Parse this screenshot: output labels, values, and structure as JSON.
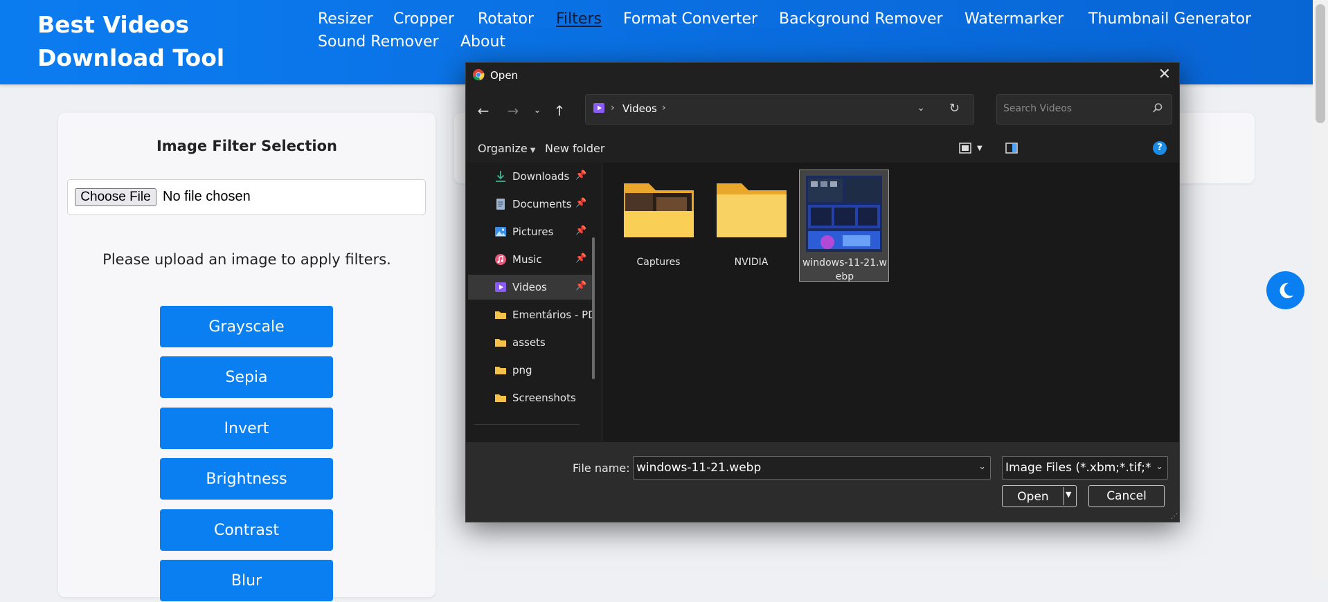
{
  "site": {
    "brand": "Best Videos Download Tool",
    "nav": [
      {
        "label": "Resizer"
      },
      {
        "label": "Cropper"
      },
      {
        "label": "Rotator"
      },
      {
        "label": "Filters",
        "active": true
      },
      {
        "label": "Format Converter"
      },
      {
        "label": "Background Remover"
      },
      {
        "label": "Watermarker"
      },
      {
        "label": "Thumbnail Generator"
      },
      {
        "label": "Sound Remover"
      },
      {
        "label": "About"
      }
    ]
  },
  "filter_panel": {
    "title": "Image Filter Selection",
    "choose_file_label": "Choose File",
    "no_file_text": "No file chosen",
    "upload_message": "Please upload an image to apply filters.",
    "buttons": [
      "Grayscale",
      "Sepia",
      "Invert",
      "Brightness",
      "Contrast",
      "Blur"
    ]
  },
  "dark_mode_toggle": {
    "icon": "moon-icon"
  },
  "dialog": {
    "title": "Open",
    "close_label": "✕",
    "address": {
      "folder": "Videos"
    },
    "search_placeholder": "Search Videos",
    "toolbar": {
      "organize": "Organize",
      "new_folder": "New folder",
      "help": "?"
    },
    "nav_pane": [
      {
        "label": "Downloads",
        "icon": "download-icon",
        "pinned": true
      },
      {
        "label": "Documents",
        "icon": "documents-icon",
        "pinned": true
      },
      {
        "label": "Pictures",
        "icon": "pictures-icon",
        "pinned": true
      },
      {
        "label": "Music",
        "icon": "music-icon",
        "pinned": true
      },
      {
        "label": "Videos",
        "icon": "videos-icon",
        "pinned": true,
        "selected": true
      },
      {
        "label": "Ementários - PD",
        "icon": "folder-icon",
        "pinned": false
      },
      {
        "label": "assets",
        "icon": "folder-icon",
        "pinned": false
      },
      {
        "label": "png",
        "icon": "folder-icon",
        "pinned": false
      },
      {
        "label": "Screenshots",
        "icon": "folder-icon",
        "pinned": false
      }
    ],
    "files": [
      {
        "name": "Captures",
        "kind": "folder-with-preview"
      },
      {
        "name": "NVIDIA",
        "kind": "folder"
      },
      {
        "name": "windows-11-21.webp",
        "kind": "image",
        "selected": true
      }
    ],
    "footer": {
      "file_name_label": "File name:",
      "file_name_value": "windows-11-21.webp",
      "file_type_value": "Image Files (*.xbm;*.tif;*.jfi",
      "open_label": "Open",
      "cancel_label": "Cancel"
    }
  },
  "colors": {
    "accent": "#0a7ff2",
    "header": "#0a6ee0",
    "dialog_bg": "#191919"
  }
}
